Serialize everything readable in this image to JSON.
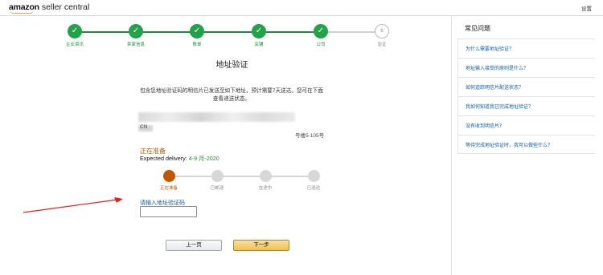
{
  "header": {
    "logo_brand": "amazon",
    "logo_rest": " seller central",
    "settings": "设置"
  },
  "steps": [
    {
      "label": "企业资讯",
      "status": "done",
      "icon": "check-icon"
    },
    {
      "label": "卖家信息",
      "status": "done",
      "icon": "check-icon"
    },
    {
      "label": "账单",
      "status": "done",
      "icon": "check-icon"
    },
    {
      "label": "店铺",
      "status": "done",
      "icon": "check-icon"
    },
    {
      "label": "公司",
      "status": "done",
      "icon": "check-icon"
    },
    {
      "label": "验证",
      "status": "pending",
      "number": "6"
    }
  ],
  "main": {
    "title": "地址验证",
    "info": "包含您地址验证码的明信片已发送至如下地址，预计需要7天送达。您可在下面查看递送状态。",
    "address_prefix": "CN",
    "address_suffix": "号楼5-105号",
    "status_label": "正在准备",
    "delivery_prefix": "Expected delivery: ",
    "delivery_dates": "4-9 月-2020",
    "tracking": [
      {
        "label": "正在准备",
        "active": true
      },
      {
        "label": "已邮送",
        "active": false
      },
      {
        "label": "在途中",
        "active": false
      },
      {
        "label": "已送达",
        "active": false
      }
    ],
    "code_label": "请输入地址验证码",
    "code_value": "",
    "prev_button": "上一页",
    "next_button": "下一步"
  },
  "sidebar": {
    "title": "常见问题",
    "items": [
      "为什么需要地址验证？",
      "地址输入接受的原则是什么？",
      "如何追踪明信片配送状态？",
      "我如何知道我已完成地址验证？",
      "没有收到明信片？",
      "等待完成地址验证时，我可以做些什么？"
    ]
  },
  "colors": {
    "step_done": "#22a34a",
    "status_orange": "#c45500",
    "link_blue": "#0b5ea8",
    "primary_button": "#f0c14b",
    "annotation_arrow": "#e02020"
  }
}
